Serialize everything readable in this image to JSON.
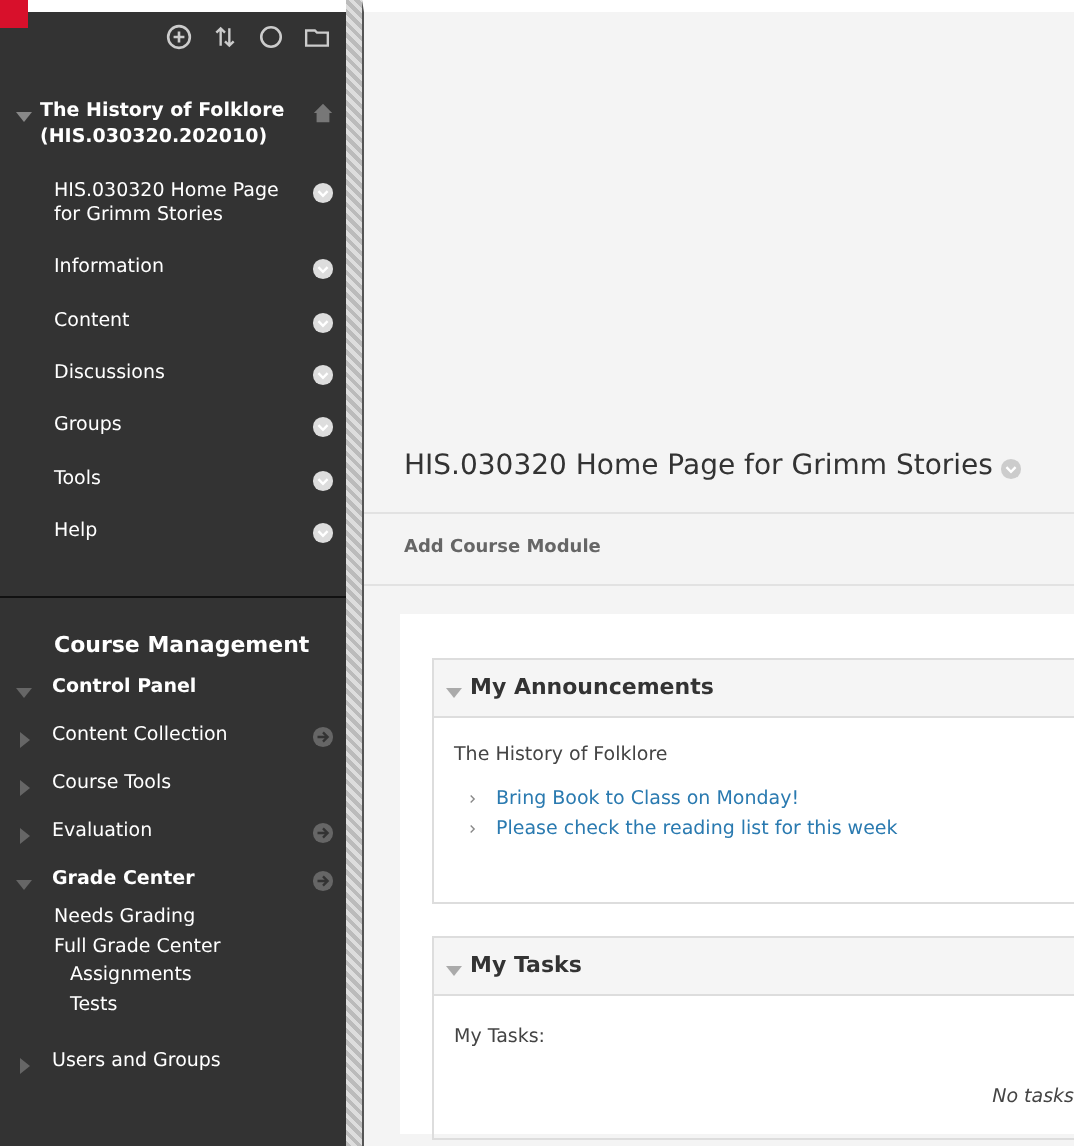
{
  "sidebar": {
    "course_title": "The History of Folklore (HIS.030320.202010)",
    "course_expanded": true,
    "course_menu": [
      {
        "label": "HIS.030320 Home Page for Grimm Stories"
      },
      {
        "label": "Information"
      },
      {
        "label": "Content"
      },
      {
        "label": "Discussions"
      },
      {
        "label": "Groups"
      },
      {
        "label": "Tools"
      },
      {
        "label": "Help"
      }
    ],
    "management_title": "Course Management",
    "control_panel": {
      "label": "Control Panel",
      "expanded": true,
      "children": [
        {
          "label": "Content Collection",
          "expanded": false,
          "quick_link": true
        },
        {
          "label": "Course Tools",
          "expanded": false,
          "quick_link": false
        },
        {
          "label": "Evaluation",
          "expanded": false,
          "quick_link": true
        },
        {
          "label": "Grade Center",
          "expanded": true,
          "quick_link": true,
          "children": [
            {
              "label": "Needs Grading"
            },
            {
              "label": "Full Grade Center",
              "children": [
                {
                  "label": "Assignments"
                },
                {
                  "label": "Tests"
                }
              ]
            }
          ]
        },
        {
          "label": "Users and Groups",
          "expanded": false,
          "quick_link": false
        }
      ]
    }
  },
  "main": {
    "page_title": "HIS.030320 Home Page for Grimm Stories",
    "add_module": "Add Course Module",
    "modules": [
      {
        "kind": "announcements",
        "title": "My Announcements",
        "expanded": true,
        "course": "The History of Folklore",
        "links": [
          "Bring Book to Class on Monday!",
          "Please check the reading list for this week"
        ]
      },
      {
        "kind": "tasks",
        "title": "My Tasks",
        "expanded": true,
        "label": "My Tasks:",
        "empty": "No tasks"
      }
    ]
  }
}
